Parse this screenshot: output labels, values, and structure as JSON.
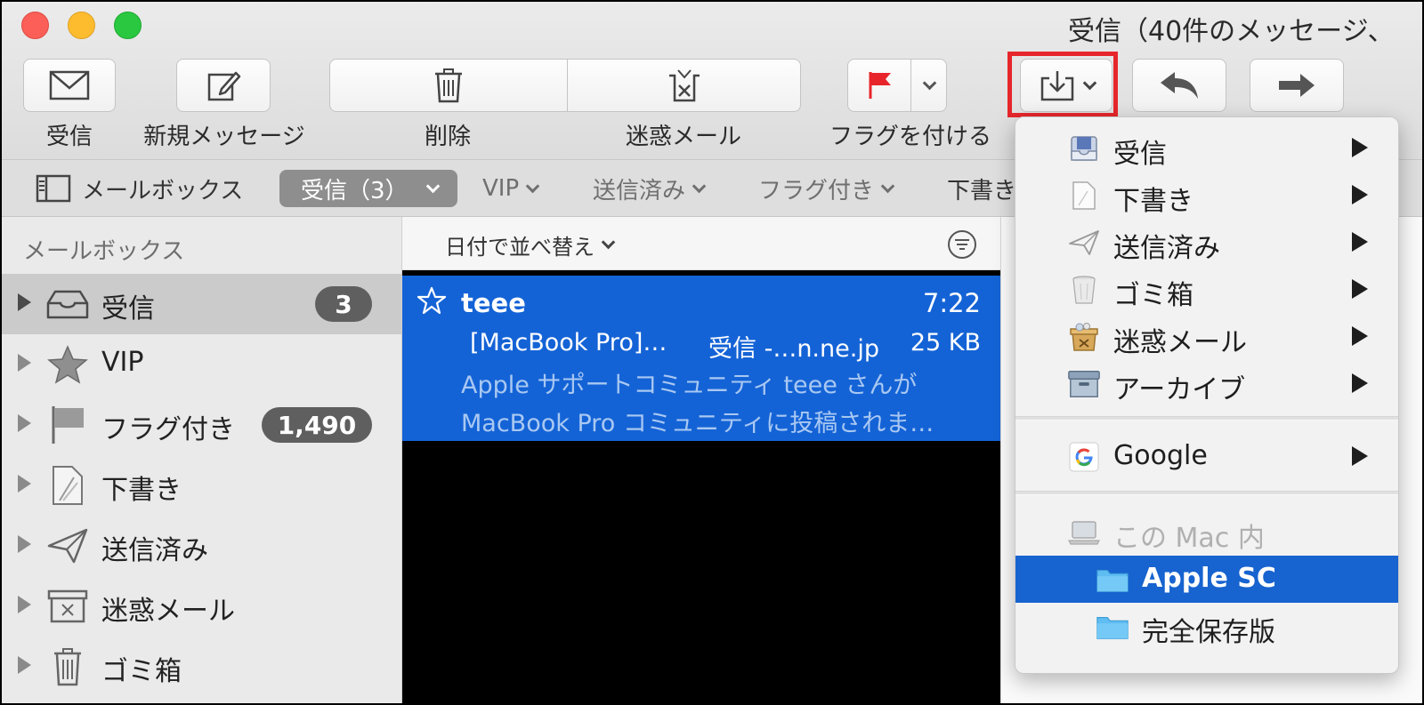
{
  "window": {
    "title": "受信（40件のメッセージ、"
  },
  "toolbar": {
    "get_mail_label": "受信",
    "compose_label": "新規メッセージ",
    "delete_label": "削除",
    "junk_label": "迷惑メール",
    "flag_label": "フラグを付ける"
  },
  "favorites": {
    "mailboxes_label": "メールボックス",
    "inbox_label": "受信（3）",
    "vip_label": "VIP",
    "sent_label": "送信済み",
    "flagged_label": "フラグ付き",
    "drafts_label": "下書き"
  },
  "sidebar": {
    "heading": "メールボックス",
    "items": [
      {
        "label": "受信",
        "badge": "3",
        "icon": "inbox-icon"
      },
      {
        "label": "VIP",
        "badge": "",
        "icon": "star-icon"
      },
      {
        "label": "フラグ付き",
        "badge": "1,490",
        "icon": "flag-icon"
      },
      {
        "label": "下書き",
        "badge": "",
        "icon": "draft-icon"
      },
      {
        "label": "送信済み",
        "badge": "",
        "icon": "paper-plane-icon"
      },
      {
        "label": "迷惑メール",
        "badge": "",
        "icon": "junk-box-icon"
      },
      {
        "label": "ゴミ箱",
        "badge": "",
        "icon": "trash-icon"
      }
    ]
  },
  "message_list": {
    "sort_label": "日付で並べ替え",
    "messages": [
      {
        "from": "teee",
        "time": "7:22",
        "subject": "[MacBook Pro]…",
        "mailbox": "受信 -…n.ne.jp",
        "size": "25 KB",
        "preview_line1": "Apple サポートコミュニティ teee さんが",
        "preview_line2": "MacBook Pro コミュニティに投稿されま…"
      }
    ]
  },
  "move_menu": {
    "items": [
      {
        "label": "受信",
        "icon": "inbox-tray-icon"
      },
      {
        "label": "下書き",
        "icon": "draft-page-icon"
      },
      {
        "label": "送信済み",
        "icon": "paper-plane-icon"
      },
      {
        "label": "ゴミ箱",
        "icon": "trash-can-icon"
      },
      {
        "label": "迷惑メール",
        "icon": "junk-box-icon"
      },
      {
        "label": "アーカイブ",
        "icon": "archive-box-icon"
      }
    ],
    "account_label": "Google",
    "local_header": "この Mac 内",
    "local_folders": [
      {
        "label": "Apple SC",
        "selected": true
      },
      {
        "label": "完全保存版",
        "selected": false
      }
    ]
  },
  "colors": {
    "selection_blue": "#1463d6",
    "menu_selection": "#1763cf",
    "highlight_red": "#e6262b",
    "flag_red": "#e8242b",
    "folder_blue": "#5fbdf2"
  }
}
